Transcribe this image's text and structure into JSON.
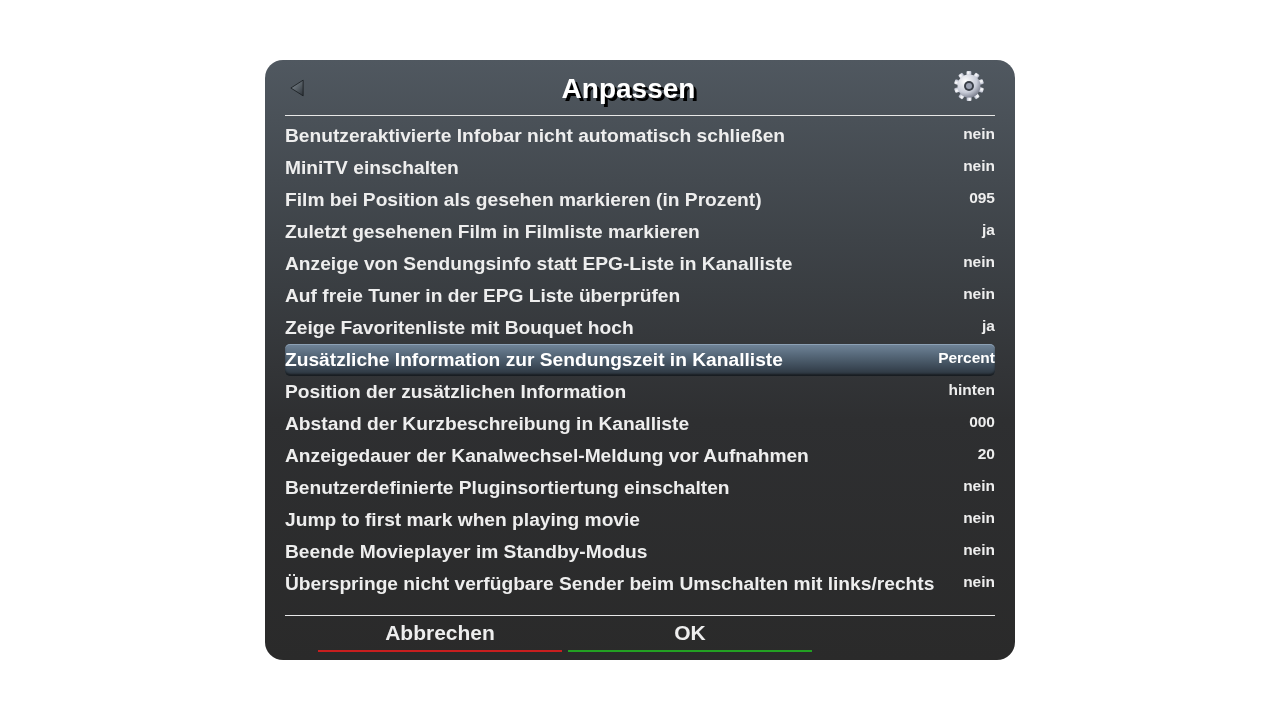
{
  "header": {
    "title": "Anpassen"
  },
  "settings": [
    {
      "label": "Benutzeraktivierte Infobar nicht automatisch schließen",
      "value": "nein",
      "selected": false
    },
    {
      "label": "MiniTV einschalten",
      "value": "nein",
      "selected": false
    },
    {
      "label": "Film bei Position als gesehen markieren (in Prozent)",
      "value": "095",
      "selected": false
    },
    {
      "label": "Zuletzt gesehenen Film in Filmliste markieren",
      "value": "ja",
      "selected": false
    },
    {
      "label": "Anzeige von Sendungsinfo statt EPG-Liste in Kanalliste",
      "value": "nein",
      "selected": false
    },
    {
      "label": "Auf freie Tuner in der EPG Liste überprüfen",
      "value": "nein",
      "selected": false
    },
    {
      "label": "Zeige Favoritenliste mit Bouquet hoch",
      "value": "ja",
      "selected": false
    },
    {
      "label": "Zusätzliche Information zur Sendungszeit in Kanalliste",
      "value": "Percent",
      "selected": true
    },
    {
      "label": "Position der zusätzlichen Information",
      "value": "hinten",
      "selected": false
    },
    {
      "label": "Abstand der Kurzbeschreibung in Kanalliste",
      "value": "000",
      "selected": false
    },
    {
      "label": "Anzeigedauer der Kanalwechsel-Meldung vor Aufnahmen",
      "value": "20",
      "selected": false
    },
    {
      "label": "Benutzerdefinierte Pluginsortiertung einschalten",
      "value": "nein",
      "selected": false
    },
    {
      "label": "Jump to first mark when playing movie",
      "value": "nein",
      "selected": false
    },
    {
      "label": "Beende Movieplayer im Standby-Modus",
      "value": "nein",
      "selected": false
    },
    {
      "label": "Überspringe nicht verfügbare Sender beim Umschalten mit links/rechts",
      "value": "nein",
      "selected": false
    }
  ],
  "buttons": [
    {
      "label": "Abbrechen",
      "color": "#c81e1e"
    },
    {
      "label": "OK",
      "color": "#22a022"
    }
  ]
}
